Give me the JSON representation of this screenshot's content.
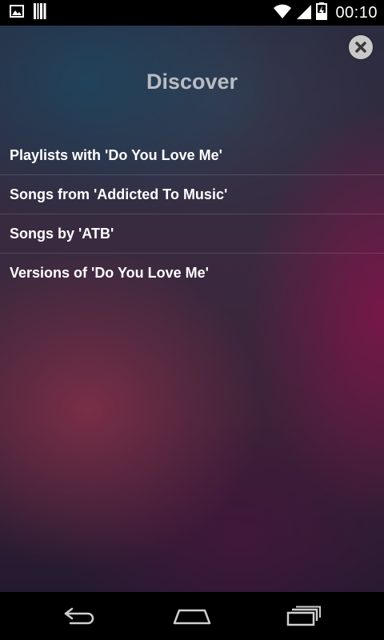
{
  "status_bar": {
    "time": "00:10",
    "left_icons": [
      "image-icon",
      "barcode-icon"
    ],
    "right_icons": [
      "wifi-icon",
      "signal-icon",
      "battery-charging-icon"
    ]
  },
  "dialog": {
    "title": "Discover",
    "close_icon": "close-icon",
    "items": [
      {
        "label": "Playlists with 'Do You Love Me'"
      },
      {
        "label": "Songs from 'Addicted To Music'"
      },
      {
        "label": "Songs by 'ATB'"
      },
      {
        "label": "Versions of 'Do You Love Me'"
      }
    ]
  },
  "nav_bar": {
    "buttons": [
      "back-icon",
      "home-icon",
      "recent-apps-icon"
    ]
  },
  "colors": {
    "title": "#b9bcc4",
    "item_text": "#ffffff",
    "close_button_bg": "#c9c9c9"
  }
}
